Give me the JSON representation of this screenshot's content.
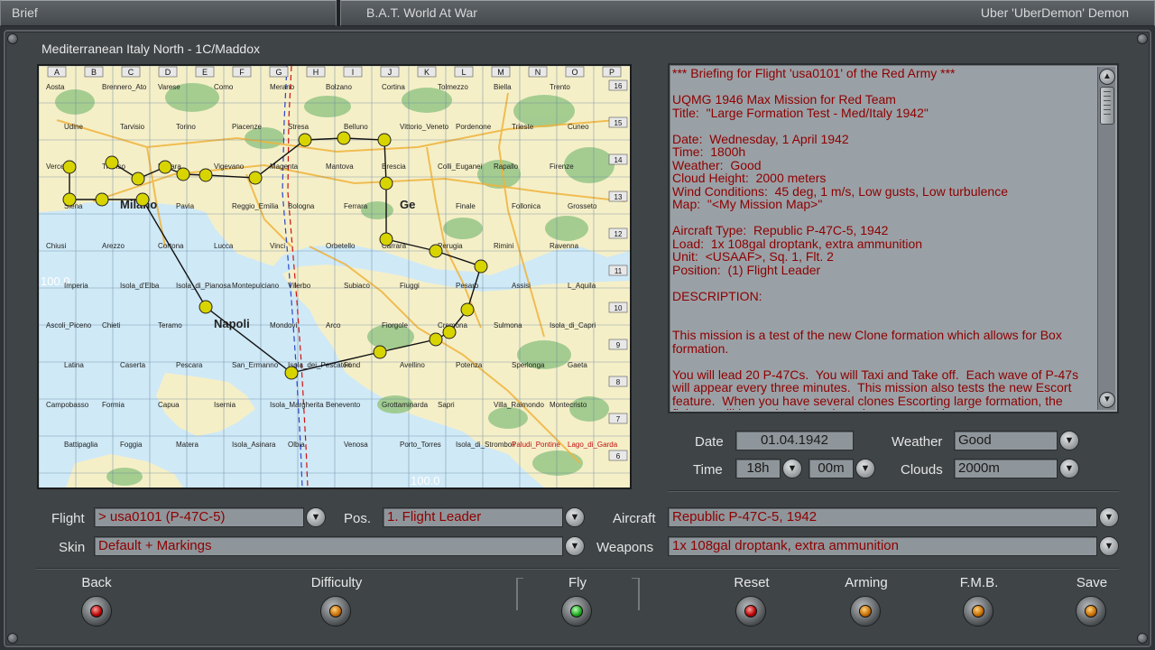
{
  "topbar": {
    "left": "Brief",
    "center": "B.A.T. World At War",
    "right": "Uber 'UberDemon' Demon"
  },
  "map": {
    "title": "Mediterranean Italy North - 1C/Maddox",
    "columns": [
      "A",
      "B",
      "C",
      "D",
      "E",
      "F",
      "G",
      "H",
      "I",
      "J",
      "K",
      "L",
      "M",
      "N",
      "O",
      "P"
    ],
    "rows": [
      "16",
      "15",
      "14",
      "13",
      "12",
      "11",
      "10",
      "9",
      "8",
      "7",
      "6"
    ],
    "scale_labels": [
      "100.0",
      "100.0"
    ],
    "cities": [
      "Aosta",
      "Brennero_Ato",
      "Varese",
      "Como",
      "Merano",
      "Bolzano",
      "Cortina",
      "Tolmezzo",
      "Biella",
      "Trento",
      "Udine",
      "Tarvisio",
      "Torino",
      "Piacenze",
      "Stresa",
      "Belluno",
      "Vittorio_Veneto",
      "Pordenone",
      "Trieste",
      "Cuneo",
      "Vercelli",
      "Treviso",
      "Novara",
      "Vigevano",
      "Magenta",
      "Mantova",
      "Brescia",
      "Colli_Euganei",
      "Rapallo",
      "Firenze",
      "Siena",
      "Milano",
      "Pavia",
      "Reggio_Emilia",
      "Bologna",
      "Ferrara",
      "Ge",
      "Finale",
      "Follonica",
      "Grosseto",
      "Chiusi",
      "Arezzo",
      "Cortona",
      "Lucca",
      "Vinci",
      "Orbetello",
      "Carrara",
      "Perugia",
      "Rimini",
      "Ravenna",
      "Imperia",
      "Isola_d'Elba",
      "Isola_di_Pianosa",
      "Montepulciano",
      "Viterbo",
      "Subiaco",
      "Fiuggi",
      "Pesaro",
      "Assisi",
      "L_Aquila",
      "Ascoli_Piceno",
      "Chieti",
      "Teramo",
      "Napoli",
      "Mondovi",
      "Arco",
      "Fiorgole",
      "Cremona",
      "Sulmona",
      "Isola_di_Capri",
      "Latina",
      "Caserta",
      "Pescara",
      "San_Ermanno",
      "Isola_dei_Pescatori",
      "Fond",
      "Avellino",
      "Potenza",
      "Sperlonga",
      "Gaeta",
      "Campobasso",
      "Formia",
      "Capua",
      "Isernia",
      "Isola_Margherita",
      "Benevento",
      "Grottaminarda",
      "Sapri",
      "Villa_Raimondo",
      "Montecristo",
      "Battipaglia",
      "Foggia",
      "Matera",
      "Isola_Asinara",
      "Olbia",
      "Venosa",
      "Porto_Torres",
      "Isola_di_Stromboli",
      "Paludi_Pontine",
      "Lago_di_Garda"
    ]
  },
  "briefing": {
    "text": "*** Briefing for Flight 'usa0101' of the Red Army ***\n\nUQMG 1946 Max Mission for Red Team\nTitle:  \"Large Formation Test - Med/Italy 1942\"\n\nDate:  Wednesday, 1 April 1942\nTime:  1800h\nWeather:  Good\nCloud Height:  2000 meters\nWind Conditions:  45 deg, 1 m/s, Low gusts, Low turbulence\nMap:  \"<My Mission Map>\"\n\nAircraft Type:  Republic P-47C-5, 1942\nLoad:  1x 108gal droptank, extra ammunition\nUnit:  <USAAF>, Sq. 1, Flt. 2\nPosition:  (1) Flight Leader\n\nDESCRIPTION:\n\n\nThis mission is a test of the new Clone formation which allows for Box formation.\n\nYou will lead 20 P-47Cs.  You will Taxi and Take off.  Each wave of P-47s will appear every three minutes.  This mission also tests the new Escort feature.  When you have several clones Escorting large formation, the fighters will be assigned random clone escorted bomber"
  },
  "conditions": {
    "date_label": "Date",
    "date_value": "01.04.1942",
    "time_label": "Time",
    "hour_value": "18h",
    "minute_value": "00m",
    "weather_label": "Weather",
    "weather_value": "Good",
    "clouds_label": "Clouds",
    "clouds_value": "2000m"
  },
  "selection": {
    "flight_label": "Flight",
    "flight_value": "> usa0101 (P-47C-5)",
    "pos_label": "Pos.",
    "pos_value": "1. Flight Leader",
    "aircraft_label": "Aircraft",
    "aircraft_value": "Republic P-47C-5, 1942",
    "skin_label": "Skin",
    "skin_value": "Default + Markings",
    "weapons_label": "Weapons",
    "weapons_value": "1x 108gal droptank, extra ammunition"
  },
  "buttons": {
    "back": "Back",
    "difficulty": "Difficulty",
    "fly": "Fly",
    "reset": "Reset",
    "arming": "Arming",
    "fmb": "F.M.B.",
    "save": "Save"
  },
  "icons": {
    "dropdown": "chevron-down-icon",
    "scroll_up": "arrow-up-icon",
    "scroll_down": "arrow-down-icon"
  },
  "colors": {
    "briefing_text": "#8e0000",
    "waypoint": "#d8d400",
    "lamp_red": "#b30000",
    "lamp_amber": "#c46a00",
    "lamp_green": "#19a519"
  }
}
